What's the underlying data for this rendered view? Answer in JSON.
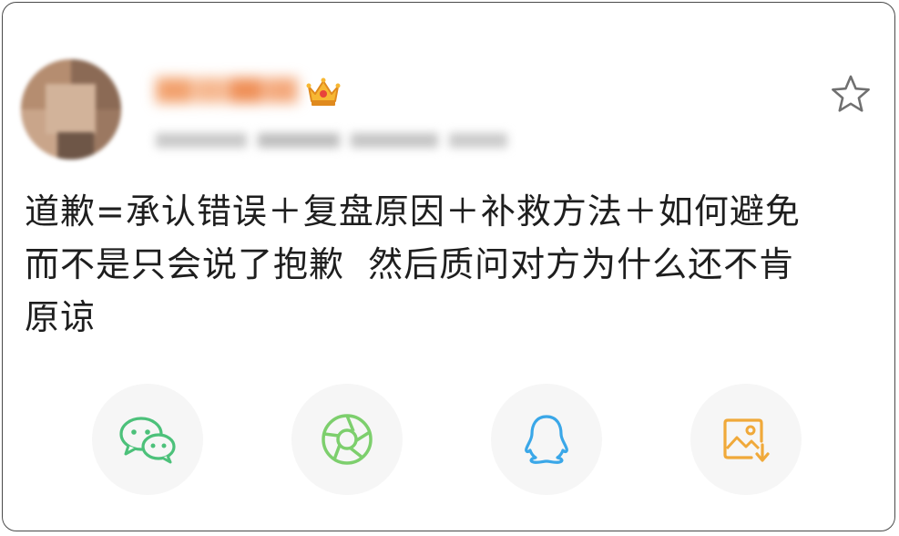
{
  "post": {
    "line1": "道歉=承认错误＋复盘原因＋补救方法＋如何避免",
    "line2": "而不是只会说了抱歉  然后质问对方为什么还不肯",
    "line3": "原谅"
  },
  "colors": {
    "wechat": "#4cc17a",
    "moments": "#7dcf6d",
    "qq": "#3aa7e8",
    "save_image": "#f0a93a",
    "star_outline": "#707070"
  },
  "share": {
    "items": [
      {
        "icon": "wechat-icon"
      },
      {
        "icon": "moments-icon"
      },
      {
        "icon": "qq-icon"
      },
      {
        "icon": "save-image-icon"
      }
    ]
  }
}
